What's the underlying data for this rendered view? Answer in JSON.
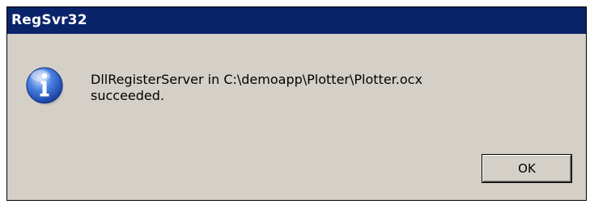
{
  "window": {
    "title": "RegSvr32",
    "title_bar_color": "#0a246a",
    "background_color": "#d4d0c8"
  },
  "message": {
    "line1": "DllRegisterServer in C:\\demoapp\\Plotter\\Plotter.ocx",
    "line2": "succeeded.",
    "icon": "information-icon"
  },
  "buttons": {
    "ok_label": "OK"
  }
}
